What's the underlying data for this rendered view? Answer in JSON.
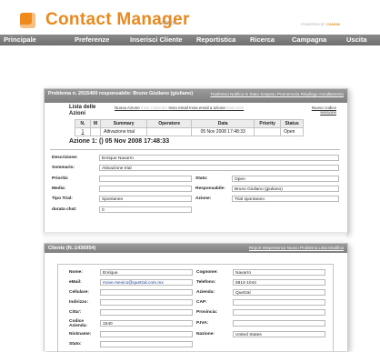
{
  "header": {
    "app_title": "Contact Manager",
    "version": "4.00.00",
    "powered_by": "POWERED BY",
    "powered_brand": "CANON"
  },
  "nav": {
    "items": [
      "Principale",
      "Preferenze",
      "Inserisci Cliente",
      "Reportistica",
      "Ricerca",
      "Campagna",
      "Uscita"
    ]
  },
  "problem_panel": {
    "title": "Problema n. 2015400 responsabile: Bruno Giuliano (giuliano)",
    "links": "Trasferisci Notifica In Stato Sospeso Promemoria Riepilogo Annullamento",
    "lista_title": "Lista delle Azioni",
    "lista_links": {
      "nuova_azione": "Nuova Azione",
      "invio_calendar": "Invio Calendar",
      "invio_email": "Invio email",
      "invia_email_azione": "Invia email a azione",
      "invio_sms": "Invio sms",
      "nuovo_codice": "Nuovo codice sessione"
    },
    "table": {
      "headers": [
        "N.",
        "M",
        "Summary",
        "Operatore",
        "Data",
        "Priority",
        "Status"
      ],
      "rows": [
        [
          "1",
          "",
          "Attivazione trial",
          "",
          "05 Nov 2008 17:48:33",
          "",
          "Open"
        ]
      ]
    },
    "azione_title": "Azione 1: () 05 Nov 2008 17:48:33",
    "form": {
      "descrizione_label": "Descrizione:",
      "descrizione": "Enrique Navarro",
      "sommario_label": "Sommario:",
      "sommario": "Attivazione trial",
      "priorita_label": "Priorità:",
      "priorita": "",
      "stato_label": "Stato:",
      "stato": "Open",
      "media_label": "Media:",
      "media": "",
      "responsabile_label": "Responsabile:",
      "responsabile": "Bruno Giuliano (giuliano)",
      "tipo_trial_label": "Tipo Trial:",
      "tipo_trial": "Spontaneo",
      "azione_label": "Azione:",
      "azione": "Trial spontaneo",
      "durata_label": "durata chat:",
      "durata": "0"
    }
  },
  "client_panel": {
    "title": "Cliente (N.:1436954)",
    "links": "Report telepresence Nuovo Problema Lista Modifica",
    "fields": {
      "nome_label": "Nome:",
      "nome": "Enrique",
      "cognome_label": "Cognome:",
      "cognome": "Navarro",
      "email_label": "eMail:",
      "email": "move.mexico@quetzal.com.mx",
      "telefono_label": "Telefono:",
      "telefono": "5814-1044",
      "cellulare_label": "Cellulare:",
      "cellulare": "",
      "azienda_label": "Azienda:",
      "azienda": "Quetzal",
      "indirizzo_label": "Indirizzo:",
      "indirizzo": "",
      "cap_label": "CAP:",
      "cap": "",
      "citta_label": "Citta':",
      "citta": "",
      "provincia_label": "Provincia:",
      "provincia": "",
      "codice_label": "Codice Azienda:",
      "codice": "1540",
      "piva_label": "P.IVA:",
      "piva": "",
      "nickname_label": "Nickname:",
      "nickname": "",
      "nazione_label": "Nazione:",
      "nazione": "United States",
      "stato_label": "Stato:",
      "stato": ""
    }
  },
  "colors": {
    "brand_orange": "#e8891e",
    "nav_gray": "#7a7a7a",
    "panel_head_gray": "#8c8c8c"
  }
}
